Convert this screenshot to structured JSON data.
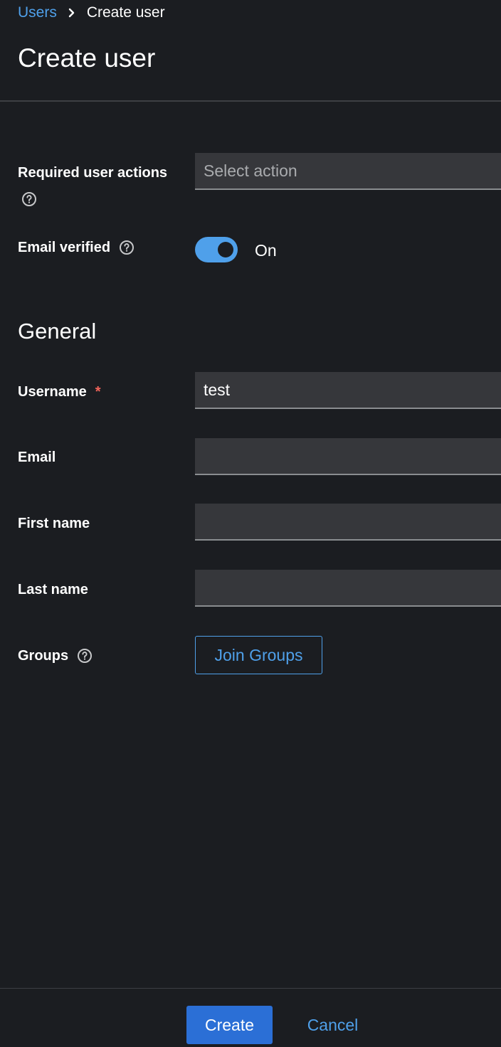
{
  "breadcrumb": {
    "parent": "Users",
    "current": "Create user"
  },
  "page": {
    "title": "Create user"
  },
  "form": {
    "required_actions": {
      "label": "Required user actions",
      "placeholder": "Select action"
    },
    "email_verified": {
      "label": "Email verified",
      "state_label": "On",
      "checked": true
    },
    "general_section_title": "General",
    "username": {
      "label": "Username",
      "required_marker": "*",
      "value": "test"
    },
    "email": {
      "label": "Email",
      "value": ""
    },
    "first_name": {
      "label": "First name",
      "value": ""
    },
    "last_name": {
      "label": "Last name",
      "value": ""
    },
    "groups": {
      "label": "Groups",
      "button_label": "Join Groups"
    }
  },
  "footer": {
    "create_label": "Create",
    "cancel_label": "Cancel"
  },
  "colors": {
    "background": "#1b1d21",
    "accent": "#4fa0ea",
    "primary_button": "#2b6fd6",
    "input_background": "#36373b",
    "required": "#f0645a"
  },
  "icons": {
    "breadcrumb_separator": "chevron-right-icon",
    "help": "question-circle-icon"
  }
}
